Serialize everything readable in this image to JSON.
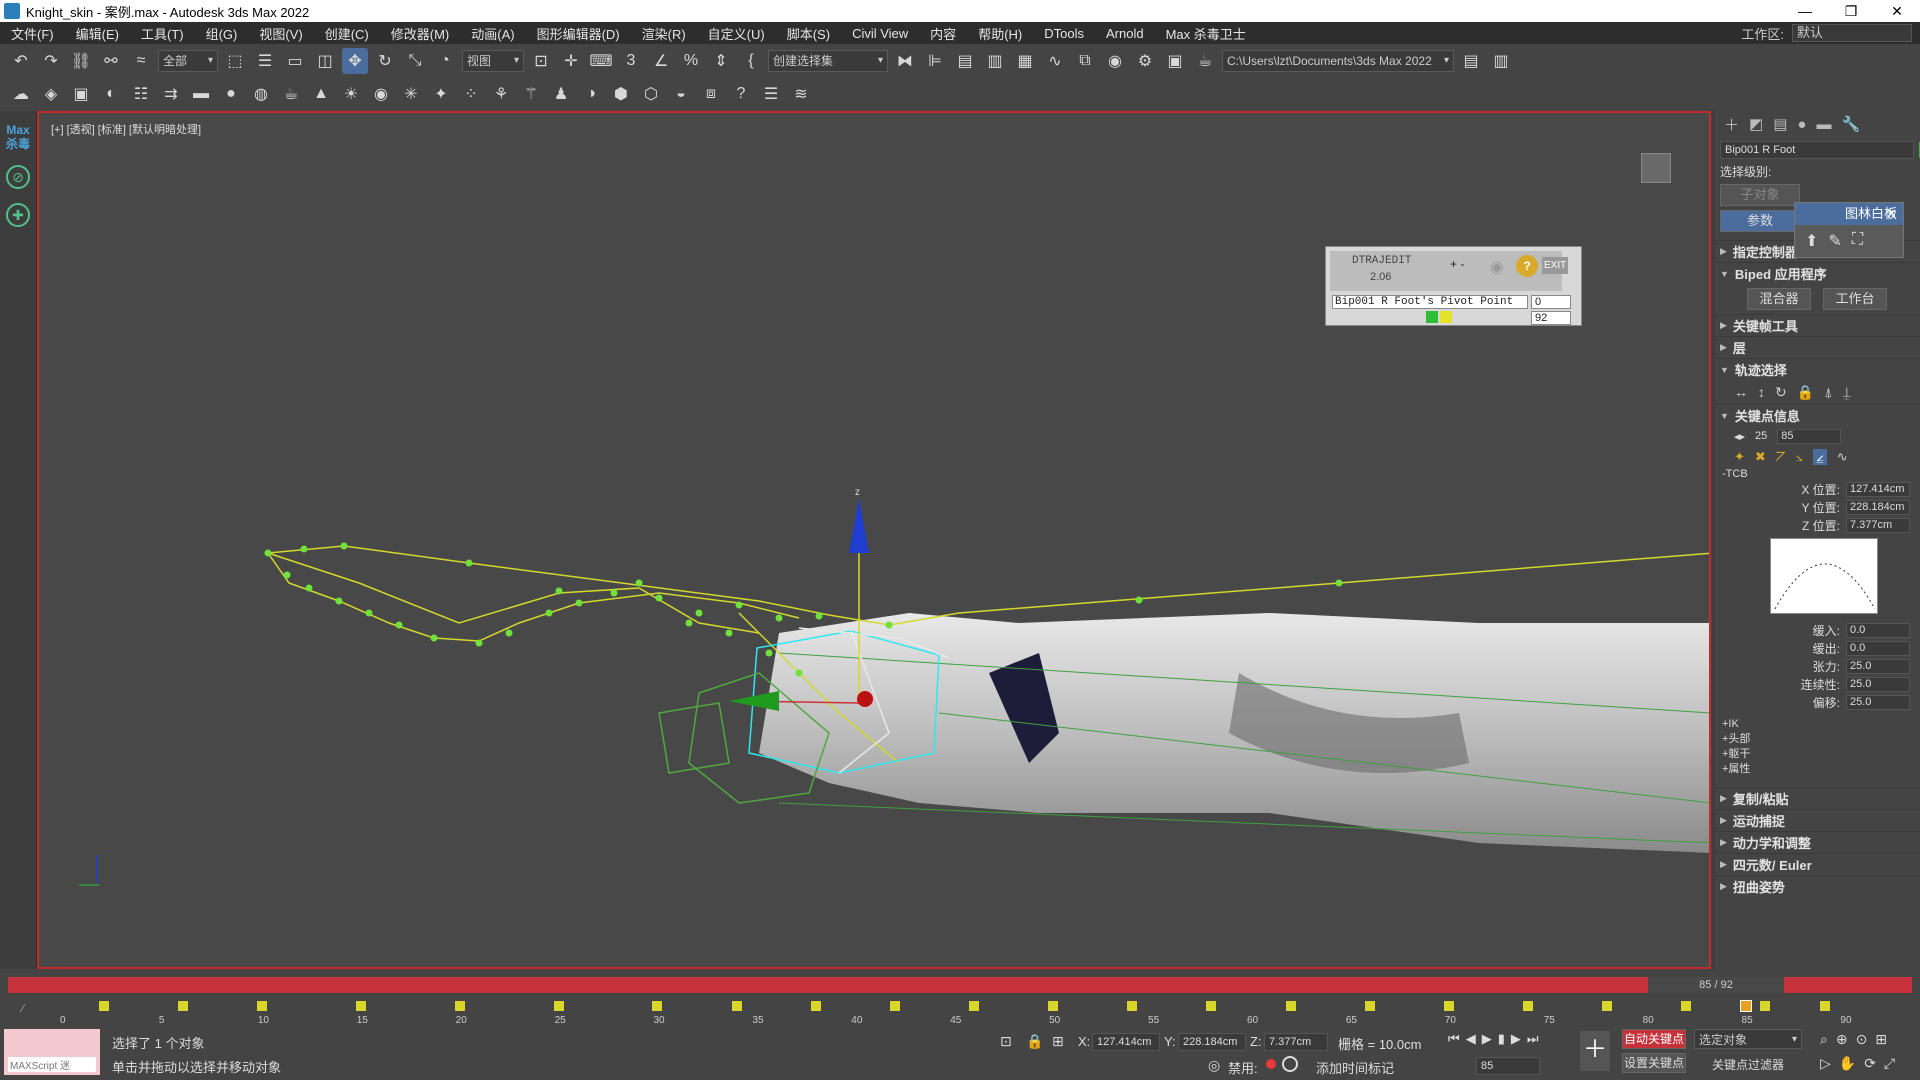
{
  "window": {
    "title": "Knight_skin - 案例.max - Autodesk 3ds Max 2022",
    "controls": [
      "—",
      "❐",
      "✕"
    ]
  },
  "menu": {
    "items": [
      "文件(F)",
      "编辑(E)",
      "工具(T)",
      "组(G)",
      "视图(V)",
      "创建(C)",
      "修改器(M)",
      "动画(A)",
      "图形编辑器(D)",
      "渲染(R)",
      "自定义(U)",
      "脚本(S)",
      "Civil View",
      "内容",
      "帮助(H)",
      "DTools",
      "Arnold",
      "Max 杀毒卫士"
    ],
    "workspace_label": "工作区:",
    "workspace_value": "默认"
  },
  "toolbar": {
    "filter": "全部",
    "ref_coord": "视图",
    "selection_set": "创建选择集",
    "project_path": "C:\\Users\\lzt\\Documents\\3ds Max 2022"
  },
  "viewport": {
    "label": "[+] [透视] [标准] [默认明暗处理]",
    "axis_z": "z"
  },
  "sidebar_left": {
    "logo": "Max\n杀毒"
  },
  "dtrajedit": {
    "title": "DTRAJEDIT",
    "version": "2.06",
    "object": "Bip001 R Foot's Pivot Point",
    "value1": "0",
    "value2": "92",
    "exit": "EXIT"
  },
  "command_panel": {
    "object_name": "Bip001 R Foot",
    "selection_level_label": "选择级别:",
    "sub_object": "子对象",
    "params_button": "参数",
    "popup_title": "图林白板",
    "rollouts": {
      "assign_controller": "指定控制器",
      "biped_app": "Biped 应用程序",
      "key_tools": "关键帧工具",
      "layers": "层",
      "track_select": "轨迹选择",
      "key_info": "关键点信息",
      "copy_paste": "复制/粘贴",
      "mocap": "运动捕捉",
      "dynamics": "动力学和调整",
      "quaternion": "四元数/ Euler",
      "twist": "扭曲姿势"
    },
    "mixer": "混合器",
    "workbench": "工作台",
    "key_num": "25",
    "key_frame": "85",
    "tcb_label": "-TCB",
    "x_pos_label": "X 位置:",
    "x_pos": "127.414cm",
    "y_pos_label": "Y 位置:",
    "y_pos": "228.184cm",
    "z_pos_label": "Z 位置:",
    "z_pos": "7.377cm",
    "ease_in_label": "缓入:",
    "ease_in": "0.0",
    "ease_out_label": "缓出:",
    "ease_out": "0.0",
    "tension_label": "张力:",
    "tension": "25.0",
    "continuity_label": "连续性:",
    "continuity": "25.0",
    "bias_label": "偏移:",
    "bias": "25.0",
    "sub_sections": [
      "+IK",
      "+头部",
      "+躯干",
      "+属性"
    ]
  },
  "timeline": {
    "frame_display": "85 / 92",
    "ticks": [
      "0",
      "5",
      "10",
      "15",
      "20",
      "25",
      "30",
      "35",
      "40",
      "45",
      "50",
      "55",
      "60",
      "65",
      "70",
      "75",
      "80",
      "85",
      "90"
    ],
    "keyframe_positions": [
      2,
      6,
      10,
      15,
      20,
      25,
      30,
      34,
      38,
      42,
      46,
      50,
      54,
      58,
      62,
      66,
      70,
      74,
      78,
      82,
      86,
      89
    ],
    "selected_key": 85
  },
  "status": {
    "maxscript": "MAXScript 迷",
    "selected": "选择了 1 个对象",
    "hint": "单击并拖动以选择并移动对象",
    "x_label": "X:",
    "x_val": "127.414cm",
    "y_label": "Y:",
    "y_val": "228.184cm",
    "z_label": "Z:",
    "z_val": "7.377cm",
    "grid": "栅格 = 10.0cm",
    "disabled": "禁用:",
    "add_time_tag": "添加时间标记",
    "auto_key": "自动关键点",
    "set_key": "设置关键点",
    "selected_object": "选定对象",
    "key_filter": "关键点过滤器",
    "current_frame": "85"
  }
}
